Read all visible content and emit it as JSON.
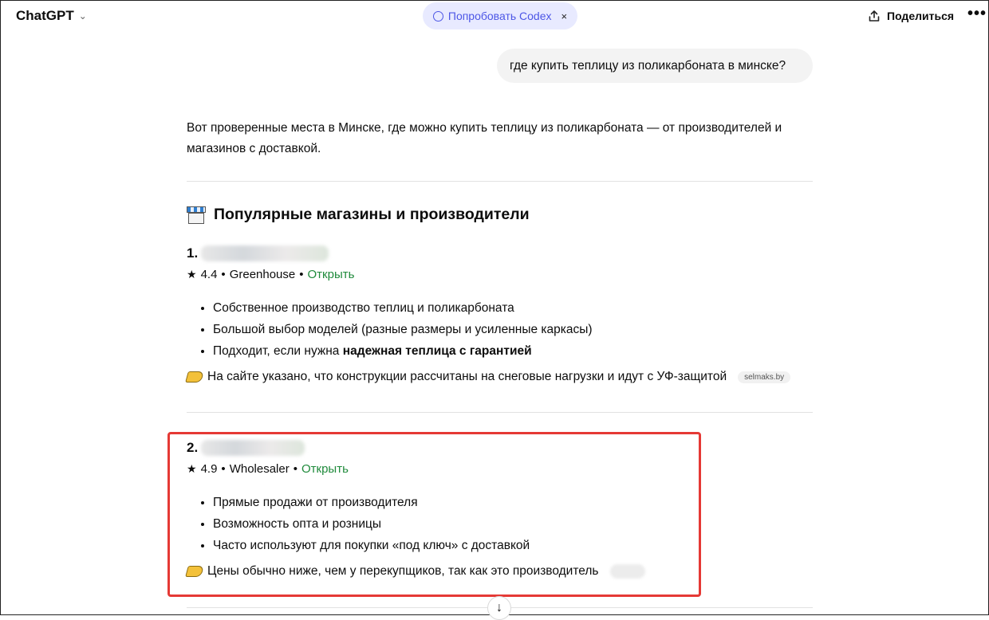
{
  "header": {
    "app_title": "ChatGPT",
    "codex_label": "Попробовать Codex",
    "codex_close": "×",
    "share_label": "Поделиться",
    "more_label": "•••"
  },
  "conversation": {
    "user_message": "где купить теплицу из поликарбоната в минске?",
    "intro": "Вот проверенные места в Минске, где можно купить теплицу из поликарбоната — от производителей и магазинов с доставкой.",
    "section_title": "Популярные магазины и производители",
    "items": [
      {
        "number": "1.",
        "rating": "4.4",
        "category": "Greenhouse",
        "open_label": "Открыть",
        "bullets": [
          "Собственное производство теплиц и поликарбоната",
          "Большой выбор моделей (разные размеры и усиленные каркасы)"
        ],
        "bullet3_prefix": "Подходит, если нужна ",
        "bullet3_bold": "надежная теплица с гарантией",
        "note": "На сайте указано, что конструкции рассчитаны на снеговые нагрузки и идут с УФ-защитой",
        "source": "selmaks.by"
      },
      {
        "number": "2.",
        "rating": "4.9",
        "category": "Wholesaler",
        "open_label": "Открыть",
        "bullets": [
          "Прямые продажи от производителя",
          "Возможность опта и розницы",
          "Часто используют для покупки «под ключ» с доставкой"
        ],
        "note": "Цены обычно ниже, чем у перекупщиков, так как это производитель"
      }
    ]
  },
  "colors": {
    "accent": "#4d57e6",
    "link_green": "#1f8a3b",
    "highlight_red": "#e53935"
  }
}
